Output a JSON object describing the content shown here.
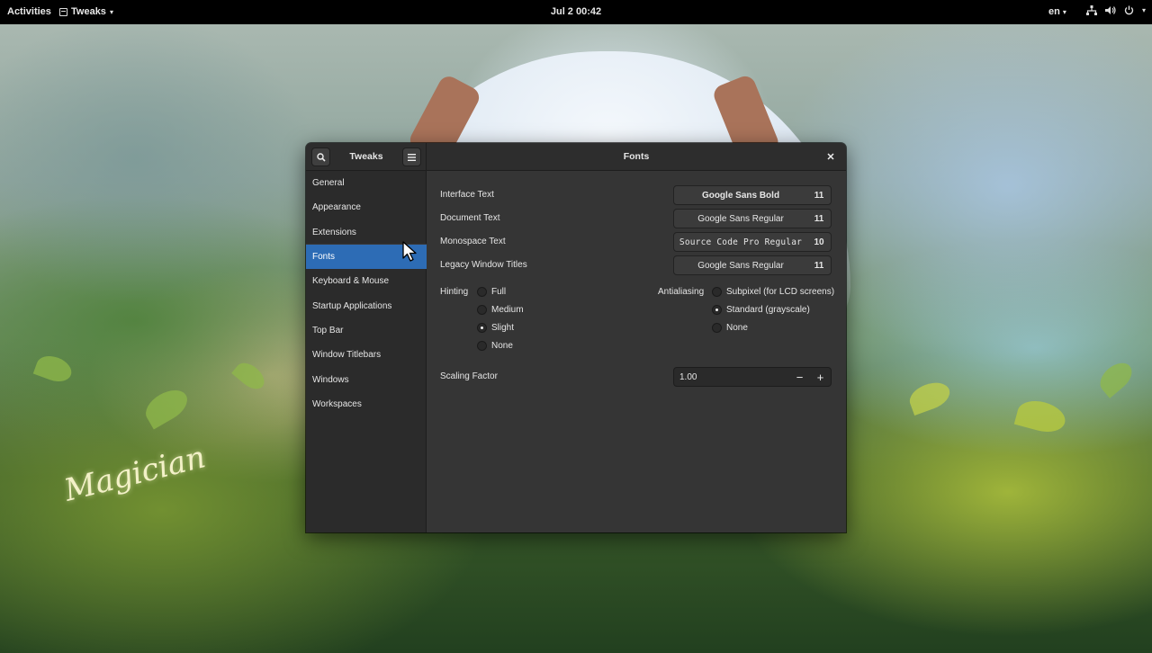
{
  "topbar": {
    "activities": "Activities",
    "app_name": "Tweaks",
    "clock": "Jul 2  00:42",
    "language": "en"
  },
  "window": {
    "app_title": "Tweaks",
    "page_title": "Fonts",
    "sidebar": {
      "items": [
        {
          "label": "General"
        },
        {
          "label": "Appearance"
        },
        {
          "label": "Extensions"
        },
        {
          "label": "Fonts",
          "active": true
        },
        {
          "label": "Keyboard & Mouse"
        },
        {
          "label": "Startup Applications"
        },
        {
          "label": "Top Bar"
        },
        {
          "label": "Window Titlebars"
        },
        {
          "label": "Windows"
        },
        {
          "label": "Workspaces"
        }
      ]
    },
    "fonts": {
      "interface": {
        "label": "Interface Text",
        "font": "Google Sans Bold",
        "size": "11"
      },
      "document": {
        "label": "Document Text",
        "font": "Google Sans Regular",
        "size": "11"
      },
      "monospace": {
        "label": "Monospace Text",
        "font": "Source Code Pro Regular",
        "size": "10"
      },
      "legacy": {
        "label": "Legacy Window Titles",
        "font": "Google Sans Regular",
        "size": "11"
      }
    },
    "hinting": {
      "label": "Hinting",
      "options": [
        "Full",
        "Medium",
        "Slight",
        "None"
      ],
      "selected": "Slight"
    },
    "antialiasing": {
      "label": "Antialiasing",
      "options": [
        "Subpixel (for LCD screens)",
        "Standard (grayscale)",
        "None"
      ],
      "selected": "Standard (grayscale)"
    },
    "scaling": {
      "label": "Scaling Factor",
      "value": "1.00",
      "minus": "−",
      "plus": "+"
    }
  },
  "wallpaper": {
    "signature": "Magician"
  },
  "colors": {
    "accent": "#2d6cb5",
    "window_bg": "#353535",
    "sidebar_bg": "#2b2b2b",
    "topbar_bg": "#000000"
  }
}
